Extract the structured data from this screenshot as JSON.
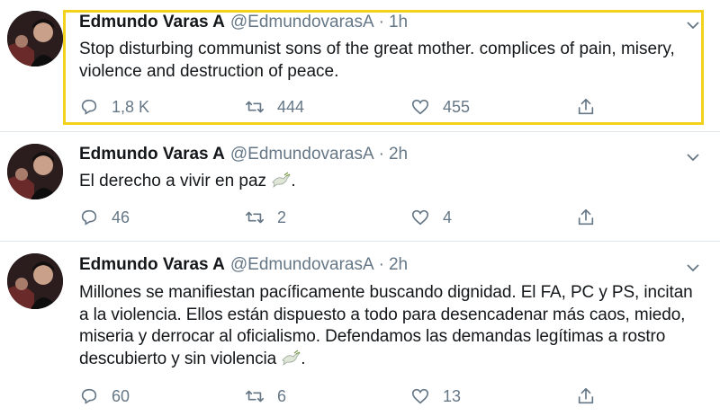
{
  "tweets": [
    {
      "name": "Edmundo Varas A",
      "handle": "@EdmundovarasA",
      "time": "1h",
      "separator": "·",
      "text": "Stop disturbing communist sons of the great mother. complices of pain, misery, violence and destruction of peace.",
      "replies": "1,8 K",
      "retweets": "444",
      "likes": "455",
      "highlighted": true
    },
    {
      "name": "Edmundo Varas A",
      "handle": "@EdmundovarasA",
      "time": "2h",
      "separator": "·",
      "text": "El derecho a vivir en paz",
      "text_suffix": ".",
      "replies": "46",
      "retweets": "2",
      "likes": "4"
    },
    {
      "name": "Edmundo Varas A",
      "handle": "@EdmundovarasA",
      "time": "2h",
      "separator": "·",
      "text": "Millones se manifiestan pacíficamente buscando dignidad. El FA, PC y PS, incitan a la violencia. Ellos están dispuesto a todo para desencadenar más caos, miedo, miseria y derrocar al oficialismo. Defendamos las demandas legítimas a rostro descubierto y sin violencia",
      "text_suffix": ".",
      "replies": "60",
      "retweets": "6",
      "likes": "13"
    }
  ],
  "colors": {
    "highlight_border": "#f2d21c",
    "secondary_text": "#657786",
    "primary_text": "#14171a",
    "divider": "#e1e8ed"
  },
  "icons": [
    "reply-icon",
    "retweet-icon",
    "like-icon",
    "share-icon",
    "chevron-down-icon",
    "dove-emoji-icon"
  ]
}
